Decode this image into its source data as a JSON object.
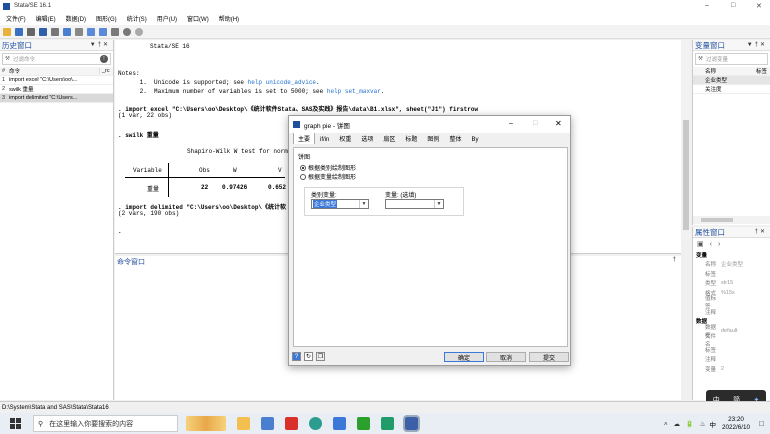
{
  "window": {
    "title": "Stata/SE 16.1"
  },
  "menu": [
    "文件(F)",
    "编辑(E)",
    "数据(D)",
    "图形(G)",
    "统计(S)",
    "用户(U)",
    "窗口(W)",
    "帮助(H)"
  ],
  "history": {
    "title": "历史窗口",
    "filter_placeholder": "过滤命令",
    "col_num": "#",
    "col_cmd": "命令",
    "col_rc": "_rc",
    "items": [
      {
        "n": "1",
        "cmd": "import excel \"C:\\Users\\oo\\..."
      },
      {
        "n": "2",
        "cmd": "swilk 重量"
      },
      {
        "n": "3",
        "cmd": "import delimited \"C:\\Users..."
      }
    ]
  },
  "results": {
    "l1": "Stata/SE 16",
    "notes": "Notes:",
    "n1": "      1.  Unicode is supported; see ",
    "n1link": "help unicode_advice",
    "n2": "      2.  Maximum number of variables is set to 5000; see ",
    "n2link": "help set_maxvar",
    "cmd1": ". import excel \"C:\\Users\\oo\\Desktop\\《统计软件Stata、SAS及实践》报告\\data\\B1.xlsx\", sheet(\"J1\") firstrow",
    "cmd1out": "(1 var, 22 obs)",
    "cmd2": ". swilk 重量",
    "swtitle": "Shapiro-Wilk W test for norm",
    "hdr_var": "Variable",
    "hdr_obs": "Obs",
    "hdr_w": "W",
    "hdr_v": "V",
    "row_var": "重量",
    "row_obs": "22",
    "row_w": "0.97426",
    "row_v": "0.652",
    "cmd3": ". import delimited \"C:\\Users\\oo\\Desktop\\《统计软",
    "cmd3out": "(2 vars, 190 obs)",
    "prompt": "."
  },
  "cmdwin": {
    "title": "命令窗口"
  },
  "variables": {
    "title": "变量窗口",
    "filter_placeholder": "过滤变量",
    "col_name": "名称",
    "col_label": "标签",
    "items": [
      "企业类型",
      "关注度"
    ]
  },
  "properties": {
    "title": "属性窗口",
    "sec_var": "变量",
    "rows_var": [
      {
        "k": "名称",
        "v": "企业类型"
      },
      {
        "k": "标签",
        "v": ""
      },
      {
        "k": "类型",
        "v": "str15"
      },
      {
        "k": "格式",
        "v": "%15s"
      },
      {
        "k": "值标签",
        "v": ""
      },
      {
        "k": "注释",
        "v": ""
      }
    ],
    "sec_data": "数据",
    "rows_data": [
      {
        "k": "数据框",
        "v": "default"
      },
      {
        "k": "文件名",
        "v": ""
      },
      {
        "k": "标签",
        "v": ""
      },
      {
        "k": "注释",
        "v": ""
      },
      {
        "k": "变量",
        "v": "2"
      }
    ]
  },
  "status": {
    "path": "D:\\System\\Stata and SAS\\Stata\\Stata16"
  },
  "taskbar": {
    "search": "在这里输入你要搜索的内容",
    "time": "23:20",
    "date": "2022/6/10",
    "ime": "中"
  },
  "ime_popup": {
    "a": "中",
    "b": "简"
  },
  "dialog": {
    "title": "graph pie - 饼图",
    "tabs": [
      "主要",
      "if/in",
      "权重",
      "选项",
      "扇区",
      "标题",
      "图例",
      "整体",
      "By"
    ],
    "group": "饼图",
    "r1": "根据类别绘制图形",
    "r2": "根据变量绘制图形",
    "cat_label": "类别变量:",
    "cat_value": "企业类型",
    "var_label": "变量: (选填)",
    "var_value": "",
    "ok": "确定",
    "cancel": "取消",
    "submit": "提交"
  },
  "colors": {
    "accent": "#1f4e9e",
    "link": "#1f6fd0",
    "selection": "#3b78d8"
  }
}
